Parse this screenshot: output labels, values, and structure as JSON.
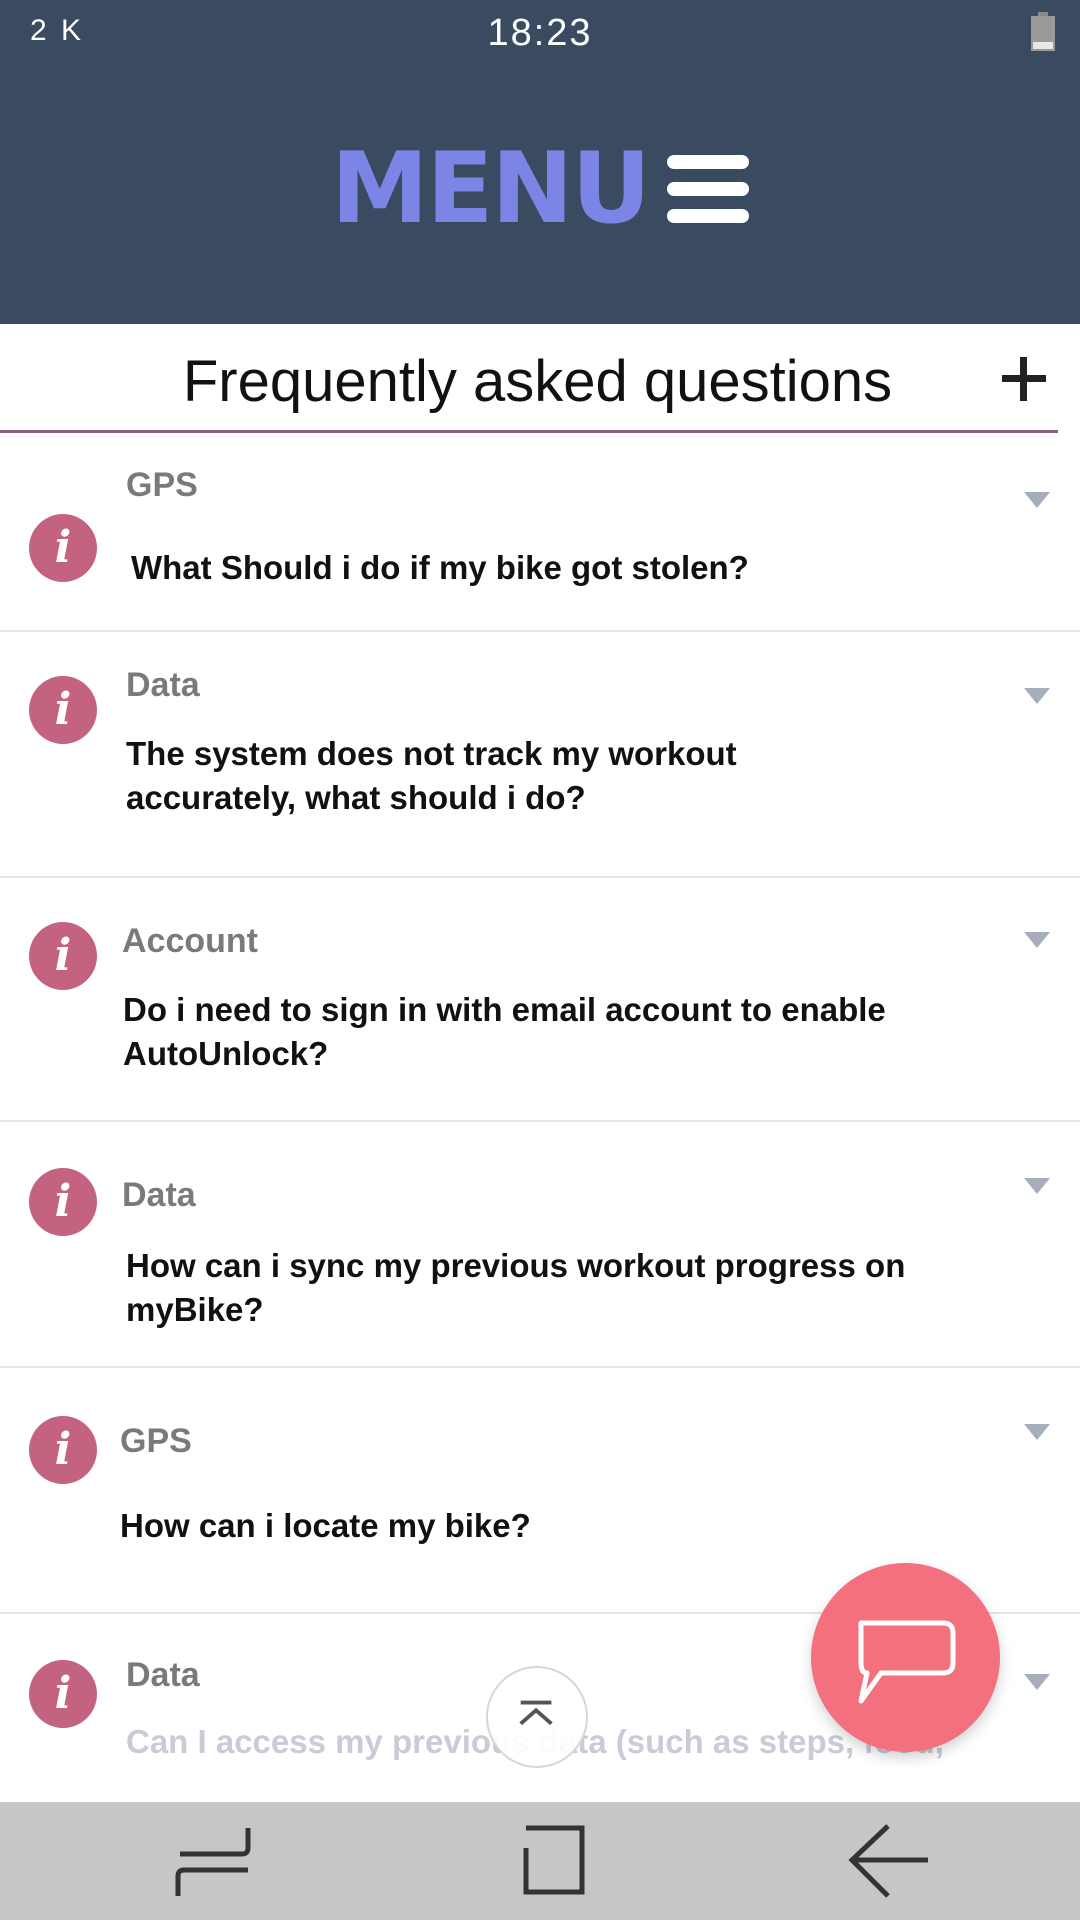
{
  "status_bar": {
    "left": "2 K",
    "time": "18:23",
    "battery_icon": "battery-icon"
  },
  "header": {
    "title": "MENU",
    "menu_icon": "hamburger-icon",
    "background": "#3a4a61",
    "title_color": "#7b85e6"
  },
  "faq": {
    "title": "Frequently asked questions",
    "add_icon": "plus-icon",
    "items": [
      {
        "category": "GPS",
        "question": "What Should i do if my bike got stolen?"
      },
      {
        "category": "Data",
        "question": "The system does not track my workout accurately, what should i do?"
      },
      {
        "category": "Account",
        "question": "Do i need to sign in with email account to enable AutoUnlock?"
      },
      {
        "category": "Data",
        "question": "How can i sync my previous workout progress on myBike?"
      },
      {
        "category": "GPS",
        "question": "How can i locate my bike?"
      },
      {
        "category": "Data",
        "question": "Can I access my previous data (such as steps, food,"
      }
    ],
    "info_icon_glyph": "i",
    "badge_color": "#c4637f"
  },
  "fab": {
    "chat_icon": "chat-bubble-icon",
    "chat_color": "#f4707e",
    "scroll_top_icon": "chevron-up-icon"
  },
  "nav": {
    "recents_icon": "recent-apps-icon",
    "home_icon": "home-icon",
    "back_icon": "back-icon"
  }
}
